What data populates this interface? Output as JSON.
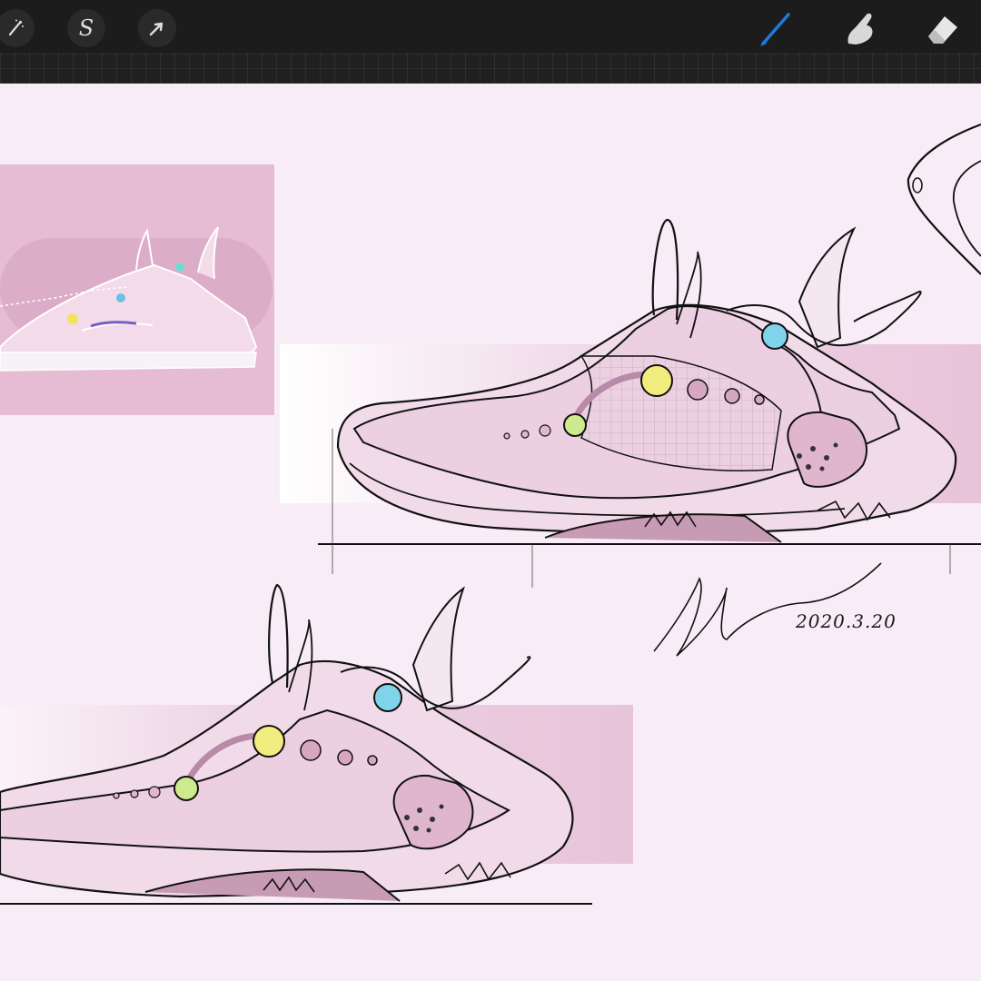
{
  "toolbar": {
    "left_tools": [
      {
        "name": "adjustments",
        "icon": "magic-wand-icon"
      },
      {
        "name": "selection",
        "icon": "selection-s-icon",
        "glyph": "S"
      },
      {
        "name": "transform",
        "icon": "arrow-cursor-icon"
      }
    ],
    "right_tools": [
      {
        "name": "brush",
        "icon": "brush-icon",
        "active": true,
        "color": "#1f7ae0"
      },
      {
        "name": "smudge",
        "icon": "smudge-finger-icon"
      },
      {
        "name": "eraser",
        "icon": "eraser-icon"
      }
    ]
  },
  "canvas": {
    "background": "#f8edf6",
    "accent_pink": "#e8c4da",
    "signature": "Y.Jan",
    "date": "2020.3.20"
  }
}
